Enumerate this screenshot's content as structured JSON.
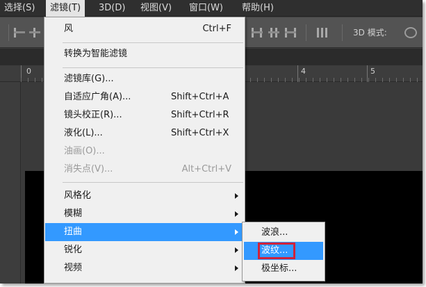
{
  "menubar": {
    "items": [
      {
        "label": "选择(S)"
      },
      {
        "label": "滤镜(T)"
      },
      {
        "label": "3D(D)"
      },
      {
        "label": "视图(V)"
      },
      {
        "label": "窗口(W)"
      },
      {
        "label": "帮助(H)"
      }
    ]
  },
  "optionsbar": {
    "mode_label": "3D 模式:"
  },
  "ruler": {
    "labels": [
      "0",
      "4",
      "5"
    ]
  },
  "filter_menu": {
    "items": [
      {
        "label": "风",
        "shortcut": "Ctrl+F"
      },
      {
        "label": "转换为智能滤镜"
      },
      {
        "label": "滤镜库(G)..."
      },
      {
        "label": "自适应广角(A)...",
        "shortcut": "Shift+Ctrl+A"
      },
      {
        "label": "镜头校正(R)...",
        "shortcut": "Shift+Ctrl+R"
      },
      {
        "label": "液化(L)...",
        "shortcut": "Shift+Ctrl+X"
      },
      {
        "label": "油画(O)...",
        "disabled": true
      },
      {
        "label": "消失点(V)...",
        "shortcut": "Alt+Ctrl+V",
        "disabled": true
      },
      {
        "label": "风格化",
        "submenu": true
      },
      {
        "label": "模糊",
        "submenu": true
      },
      {
        "label": "扭曲",
        "submenu": true,
        "highlighted": true
      },
      {
        "label": "锐化",
        "submenu": true
      },
      {
        "label": "视频",
        "submenu": true
      }
    ]
  },
  "distort_submenu": {
    "items": [
      {
        "label": "波浪..."
      },
      {
        "label": "波纹...",
        "highlighted": true,
        "annotated": true
      },
      {
        "label": "极坐标..."
      }
    ]
  },
  "colors": {
    "menu_highlight": "#3399ff",
    "annotation_box": "#d0223a",
    "menubar_bg": "#2f2f2f"
  }
}
